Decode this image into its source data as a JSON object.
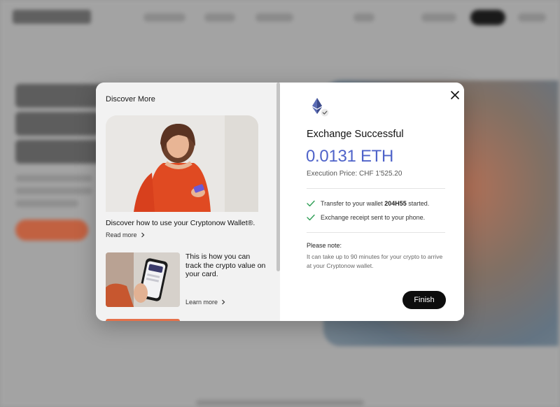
{
  "modal": {
    "left": {
      "title": "Discover More",
      "card1": {
        "title": "Discover how to use your Cryptonow Wallet®.",
        "link": "Read more"
      },
      "card2": {
        "title": "This is how you can track the crypto value on your card.",
        "link": "Learn more"
      }
    },
    "right": {
      "title": "Exchange Successful",
      "amount": "0.0131 ETH",
      "execution_price": "Execution Price: CHF 1'525.20",
      "checks": [
        {
          "prefix": "Transfer to your wallet ",
          "bold": "204H55",
          "suffix": " started."
        },
        {
          "prefix": "Exchange receipt sent to your phone.",
          "bold": "",
          "suffix": ""
        }
      ],
      "note_title": "Please note:",
      "note_text": "It can take up to 90 minutes for your crypto to arrive at your Cryptonow wallet.",
      "finish_label": "Finish"
    }
  },
  "icons": {
    "close": "close-icon",
    "eth": "ethereum-icon",
    "check": "checkmark-icon",
    "chevron": "chevron-right-icon"
  },
  "colors": {
    "accent": "#4f63c9",
    "check": "#2e9e55",
    "button_bg": "#0d0d0d"
  }
}
